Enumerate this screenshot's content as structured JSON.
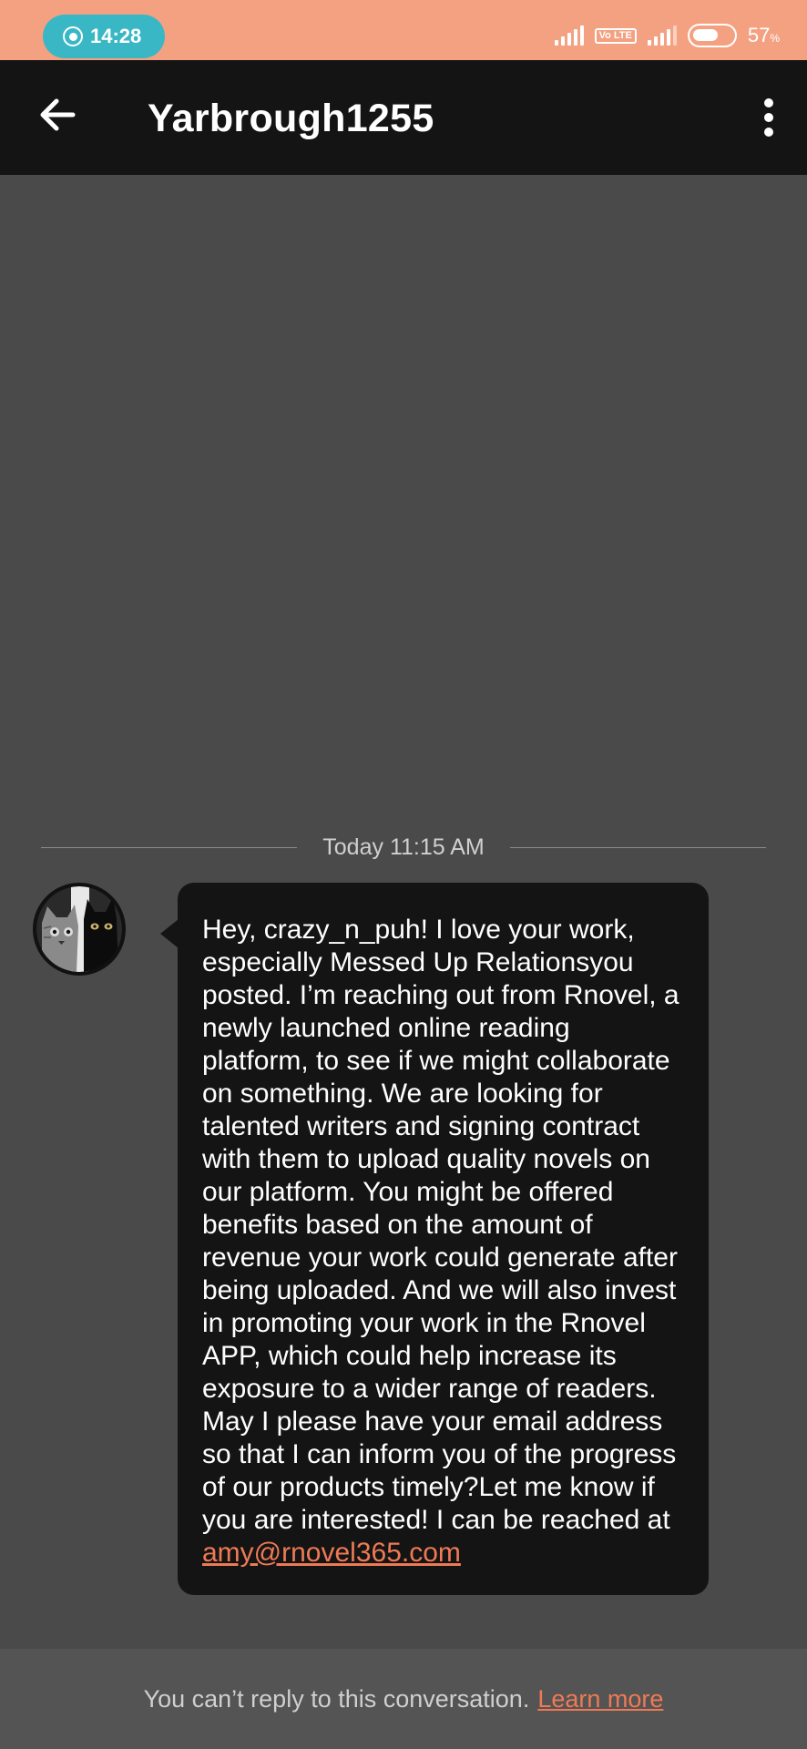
{
  "status_bar": {
    "time": "14:28",
    "volte_label": "Vo LTE",
    "battery_percent": "57",
    "battery_unit": "%",
    "color": "#f4a182",
    "pill_color": "#3ab7c4"
  },
  "header": {
    "title": "Yarbrough1255",
    "back_icon": "arrow-left-icon",
    "menu_icon": "more-vertical-icon"
  },
  "conversation": {
    "date_label": "Today 11:15 AM",
    "message": {
      "text": "Hey, crazy_n_puh! I love your work, especially Messed Up Relationsyou posted. I’m reaching out from Rnovel, a newly launched online reading platform, to see if we might collaborate on something. We are looking for talented writers and signing contract with them to upload quality novels on our platform. You might be offered benefits based on the amount of revenue your work could generate after being uploaded. And we will also invest in promoting your work in the Rnovel APP, which could help increase its exposure to a wider range of readers. May I please have your email address so that I can inform you of the progress of our products timely?Let me know if you are interested! I can be reached at",
      "link": "amy@rnovel365.com"
    }
  },
  "footer": {
    "notice": "You can’t reply to this conversation.",
    "learn_more": "Learn more",
    "link_color": "#ee7a55"
  }
}
